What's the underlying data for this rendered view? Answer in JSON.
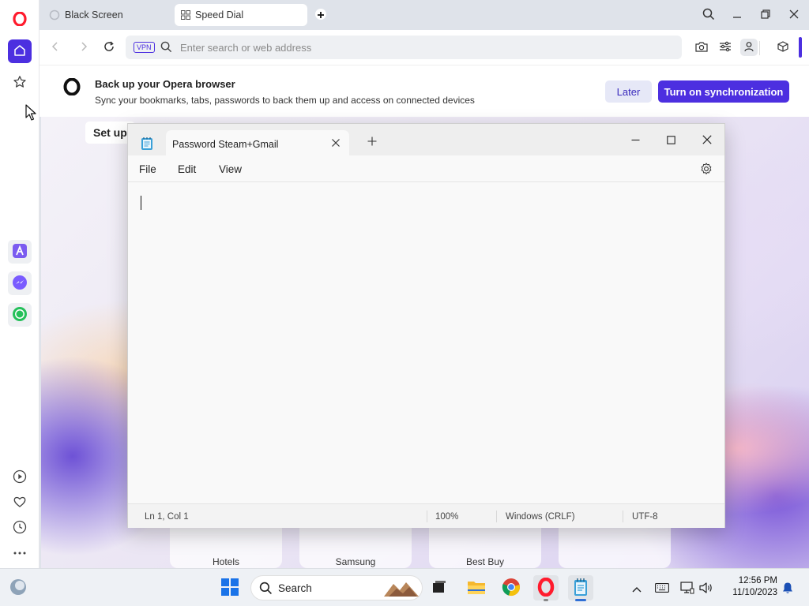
{
  "tabs": [
    {
      "label": "Black Screen",
      "active": false
    },
    {
      "label": "Speed Dial",
      "active": true
    }
  ],
  "toolbar": {
    "vpn_badge": "VPN",
    "url_placeholder": "Enter search or web address"
  },
  "banner": {
    "title": "Back up your Opera browser",
    "subtitle": "Sync your bookmarks, tabs, passwords to back them up and access on connected devices",
    "later_label": "Later",
    "sync_label": "Turn on synchronization"
  },
  "speed_dial": {
    "setup_tip": "Set up",
    "tiles": [
      "Hotels",
      "Samsung",
      "Best Buy",
      ""
    ]
  },
  "notepad": {
    "tab_title": "Password Steam+Gmail",
    "menu": [
      "File",
      "Edit",
      "View"
    ],
    "content": "",
    "status": {
      "position": "Ln 1, Col 1",
      "zoom": "100%",
      "line_ending": "Windows (CRLF)",
      "encoding": "UTF-8"
    }
  },
  "taskbar": {
    "search_label": "Search",
    "time": "12:56 PM",
    "date": "11/10/2023"
  },
  "colors": {
    "opera_accent": "#4c2fe0",
    "opera_red": "#ff1b2d"
  }
}
